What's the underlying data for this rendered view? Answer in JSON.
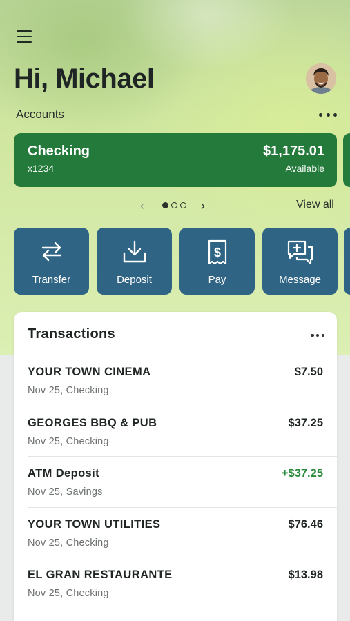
{
  "header": {
    "greeting": "Hi, Michael"
  },
  "accounts": {
    "section_label": "Accounts",
    "cards": [
      {
        "name": "Checking",
        "number": "x1234",
        "balance": "$1,175.01",
        "balance_label": "Available"
      }
    ],
    "pager": {
      "current_page": 1,
      "total_pages": 3
    },
    "view_all_label": "View all"
  },
  "quick_actions": [
    {
      "label": "Transfer",
      "icon": "transfer-arrows-icon"
    },
    {
      "label": "Deposit",
      "icon": "download-tray-icon"
    },
    {
      "label": "Pay",
      "icon": "receipt-dollar-icon"
    },
    {
      "label": "Message",
      "icon": "chat-plus-icon"
    }
  ],
  "transactions": {
    "title": "Transactions",
    "items": [
      {
        "merchant": "YOUR TOWN CINEMA",
        "meta": "Nov 25, Checking",
        "amount": "$7.50",
        "type": "debit"
      },
      {
        "merchant": "GEORGES BBQ & PUB",
        "meta": "Nov 25, Checking",
        "amount": "$37.25",
        "type": "debit"
      },
      {
        "merchant": "ATM Deposit",
        "meta": "Nov 25, Savings",
        "amount": "+$37.25",
        "type": "credit"
      },
      {
        "merchant": "YOUR TOWN UTILITIES",
        "meta": "Nov 25, Checking",
        "amount": "$76.46",
        "type": "debit"
      },
      {
        "merchant": "EL GRAN RESTAURANTE",
        "meta": "Nov 25, Checking",
        "amount": "$13.98",
        "type": "debit"
      }
    ]
  },
  "colors": {
    "account_card": "#237a3b",
    "action_tile": "#2f6484",
    "credit_amount": "#2c8a3c"
  }
}
